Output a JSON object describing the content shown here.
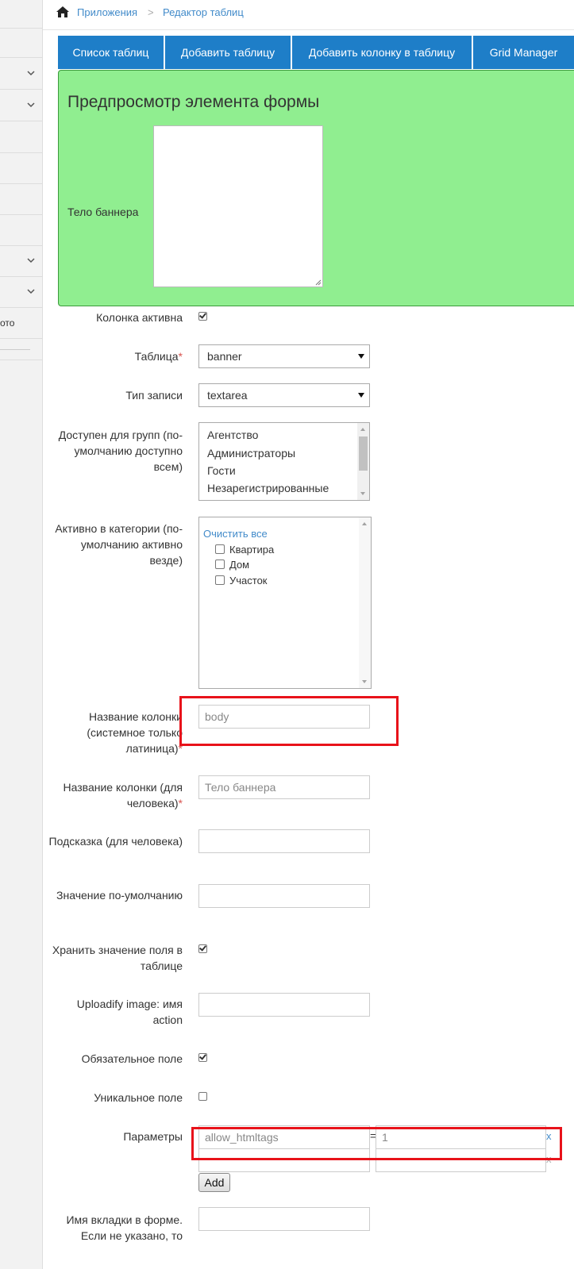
{
  "sidebar": {
    "truncated_item": "ото"
  },
  "breadcrumb": {
    "items": [
      "Приложения",
      "Редактор таблиц"
    ],
    "separator": ">"
  },
  "tabs": [
    {
      "label": "Список таблиц"
    },
    {
      "label": "Добавить таблицу"
    },
    {
      "label": "Добавить колонку в таблицу"
    },
    {
      "label": "Grid Manager"
    }
  ],
  "preview": {
    "title": "Предпросмотр элемента формы",
    "field_label": "Тело баннера",
    "background": "#90ee90"
  },
  "form": {
    "active": {
      "label": "Колонка активна",
      "checked": true
    },
    "table": {
      "label": "Таблица",
      "value": "banner"
    },
    "type": {
      "label": "Тип записи",
      "value": "textarea"
    },
    "groups": {
      "label": "Доступен для групп (по-умолчанию доступно всем)",
      "options": [
        "Агентство",
        "Администраторы",
        "Гости",
        "Незарегистрированные"
      ]
    },
    "categories": {
      "label": "Активно в категории (по-умолчанию активно везде)",
      "clear_all": "Очистить все",
      "items": [
        "Квартира",
        "Дом",
        "Участок"
      ]
    },
    "system_name": {
      "label": "Название колонки (системное только латиница)",
      "value": "body"
    },
    "human_name": {
      "label": "Название колонки (для человека)",
      "value": "Тело баннера"
    },
    "hint": {
      "label": "Подсказка (для человека)",
      "value": ""
    },
    "default": {
      "label": "Значение по-умолчанию",
      "value": ""
    },
    "store": {
      "label": "Хранить значение поля в таблице",
      "checked": true
    },
    "uploadify": {
      "label": "Uploadify image: имя action",
      "value": ""
    },
    "required": {
      "label": "Обязательное поле",
      "checked": true
    },
    "unique": {
      "label": "Уникальное поле",
      "checked": false
    },
    "params": {
      "label": "Параметры",
      "rows": [
        {
          "key": "allow_htmltags",
          "value": "1",
          "remove": "x"
        },
        {
          "key": "",
          "value": "",
          "remove": "x"
        }
      ],
      "eq": "=",
      "add_label": "Add"
    },
    "tab_name": {
      "label": "Имя вкладки в форме. Если не указано, то",
      "value": ""
    }
  },
  "colors": {
    "accent": "#1e7ec8",
    "link": "#428bca",
    "highlight": "#e8121a",
    "required": "#d9534f"
  }
}
